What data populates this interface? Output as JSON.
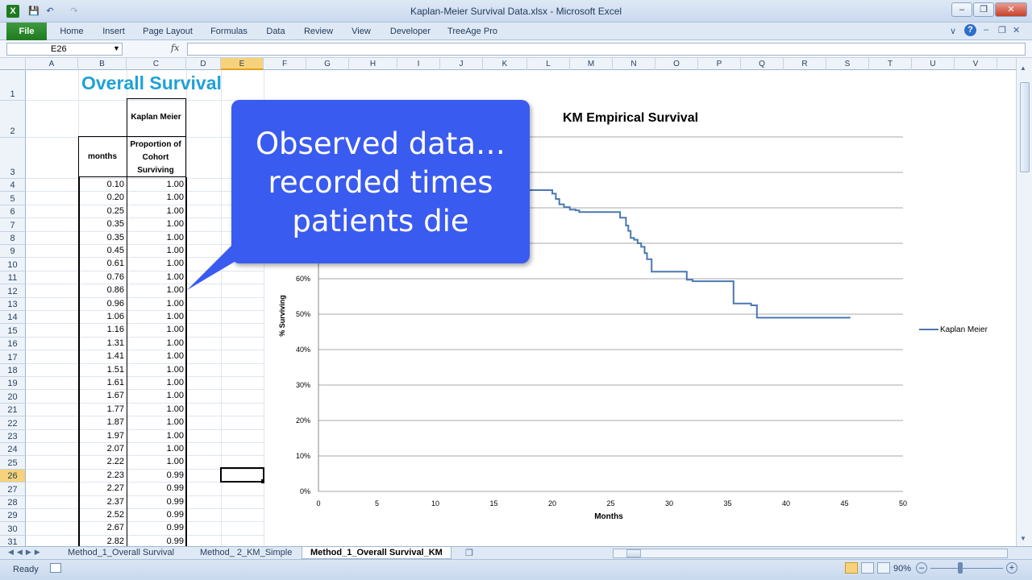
{
  "window": {
    "title": "Kaplan-Meier Survival Data.xlsx - Microsoft Excel"
  },
  "ribbon": {
    "tabs": [
      "File",
      "Home",
      "Insert",
      "Page Layout",
      "Formulas",
      "Data",
      "Review",
      "View",
      "Developer",
      "TreeAge Pro"
    ]
  },
  "formula_bar": {
    "name_box": "E26",
    "fx": "fx",
    "value": ""
  },
  "columns": [
    "A",
    "B",
    "C",
    "D",
    "E",
    "F",
    "G",
    "H",
    "I",
    "J",
    "K",
    "L",
    "M",
    "N",
    "O",
    "P",
    "Q",
    "R",
    "S",
    "T",
    "U",
    "V"
  ],
  "selected_column": "E",
  "rows": [
    "1",
    "2",
    "3",
    "4",
    "5",
    "6",
    "7",
    "8",
    "9",
    "10",
    "11",
    "12",
    "13",
    "14",
    "15",
    "16",
    "17",
    "18",
    "19",
    "20",
    "21",
    "22",
    "23",
    "24",
    "25",
    "26",
    "27",
    "28",
    "29",
    "30",
    "31"
  ],
  "selected_row": "26",
  "sheet": {
    "heading": "Overall Survival",
    "header_c2": "Kaplan Meier",
    "header_b3": "months",
    "header_c3": "Proportion of Cohort Surviving",
    "months": [
      "0.10",
      "0.20",
      "0.25",
      "0.35",
      "0.35",
      "0.45",
      "0.61",
      "0.76",
      "0.86",
      "0.96",
      "1.06",
      "1.16",
      "1.31",
      "1.41",
      "1.51",
      "1.61",
      "1.67",
      "1.77",
      "1.87",
      "1.97",
      "2.07",
      "2.22",
      "2.23",
      "2.27",
      "2.37",
      "2.52",
      "2.67",
      "2.82"
    ],
    "surviving": [
      "1.00",
      "1.00",
      "1.00",
      "1.00",
      "1.00",
      "1.00",
      "1.00",
      "1.00",
      "1.00",
      "1.00",
      "1.00",
      "1.00",
      "1.00",
      "1.00",
      "1.00",
      "1.00",
      "1.00",
      "1.00",
      "1.00",
      "1.00",
      "1.00",
      "1.00",
      "0.99",
      "0.99",
      "0.99",
      "0.99",
      "0.99",
      "0.99"
    ]
  },
  "callout": {
    "line1": "Observed data…",
    "line2": "recorded times",
    "line3": "patients die"
  },
  "chart_data": {
    "type": "line",
    "title": "KM Empirical Survival",
    "xlabel": "Months",
    "ylabel": "% Surviving",
    "xlim": [
      0,
      50
    ],
    "ylim": [
      0,
      100
    ],
    "x_ticks": [
      "0",
      "5",
      "10",
      "15",
      "20",
      "25",
      "30",
      "35",
      "40",
      "45",
      "50"
    ],
    "y_ticks": [
      "0%",
      "10%",
      "20%",
      "30%",
      "40%",
      "50%",
      "60%"
    ],
    "grid": true,
    "legend": "right",
    "series": [
      {
        "name": "Kaplan Meier",
        "color": "#4a78b0",
        "x": [
          17,
          18.5,
          19.5,
          20,
          20.3,
          20.6,
          21,
          21.5,
          22,
          22.3,
          24,
          25.8,
          26.3,
          26.5,
          26.7,
          27,
          27.3,
          27.6,
          27.9,
          28.1,
          28.5,
          30,
          31.5,
          32,
          35,
          35.5,
          37,
          37.5,
          45.5
        ],
        "y": [
          85,
          85,
          85,
          84,
          82.5,
          81,
          80.2,
          79.5,
          79.3,
          78.8,
          78.8,
          77.2,
          75,
          73.5,
          71.5,
          71,
          70,
          69,
          67.2,
          65.5,
          62,
          62,
          59.7,
          59.3,
          59.3,
          53,
          52.5,
          49,
          49
        ]
      }
    ]
  },
  "sheet_tabs": [
    "Method_1_Overall Survival",
    "Method_ 2_KM_Simple",
    "Method_1_Overall Survival_KM"
  ],
  "active_sheet": "Method_1_Overall Survival_KM",
  "status": {
    "ready": "Ready",
    "zoom": "90%"
  }
}
